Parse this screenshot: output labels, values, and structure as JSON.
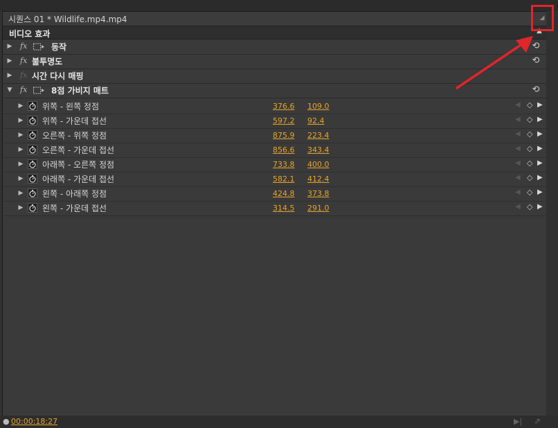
{
  "panel": {
    "title": "시퀀스 01 * Wildlife.mp4.mp4",
    "menu_icon": "panel-menu-icon"
  },
  "section": {
    "label": "비디오 효과"
  },
  "effects": [
    {
      "name": "동작",
      "expanded": false,
      "has_mask": true,
      "fx_enabled": true,
      "has_reset": true
    },
    {
      "name": "불투명도",
      "expanded": false,
      "has_mask": false,
      "fx_enabled": true,
      "has_reset": true
    },
    {
      "name": "시간 다시 매핑",
      "expanded": false,
      "has_mask": false,
      "fx_enabled": false,
      "has_reset": false
    },
    {
      "name": "8점 가비지 매트",
      "expanded": true,
      "has_mask": true,
      "fx_enabled": true,
      "has_reset": true
    }
  ],
  "params": [
    {
      "name": "위쪽 - 왼쪽 정점",
      "x": "376.6",
      "y": "109.0"
    },
    {
      "name": "위쪽 - 가운데 접선",
      "x": "597.2",
      "y": "92.4"
    },
    {
      "name": "오른쪽 - 위쪽 정점",
      "x": "875.9",
      "y": "223.4"
    },
    {
      "name": "오른쪽 - 가운데 접선",
      "x": "856.6",
      "y": "343.4"
    },
    {
      "name": "아래쪽 - 오른쪽 정점",
      "x": "733.8",
      "y": "400.0"
    },
    {
      "name": "아래쪽 - 가운데 접선",
      "x": "582.1",
      "y": "412.4"
    },
    {
      "name": "왼쪽 - 아래쪽 정점",
      "x": "424.8",
      "y": "373.8"
    },
    {
      "name": "왼쪽 - 가운데 접선",
      "x": "314.5",
      "y": "291.0"
    }
  ],
  "footer": {
    "timecode": "00:00:18:27"
  },
  "colors": {
    "value": "#e8a52a",
    "highlight": "#e0252b",
    "panel_bg": "#3a3a3a"
  }
}
